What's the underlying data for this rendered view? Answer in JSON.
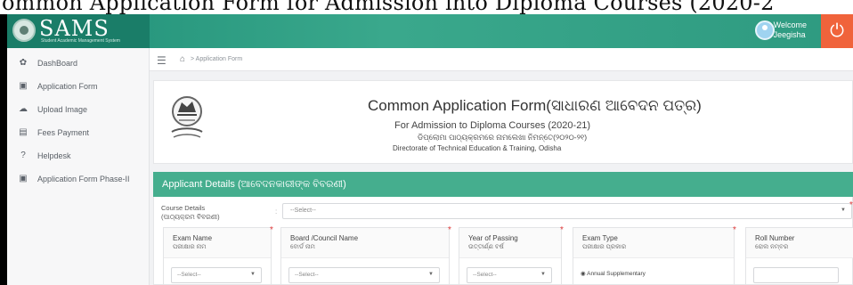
{
  "caption": "ommon Application Form for Admission into Diploma Courses (2020-2",
  "header": {
    "brand": "SAMS",
    "brand_sub": "Student Academic Management System",
    "welcome_line1": "Welcome",
    "welcome_line2": "Jeegisha",
    "power_icon": "power-icon"
  },
  "sidebar": {
    "items": [
      {
        "label": "DashBoard",
        "icon": "dashboard-icon"
      },
      {
        "label": "Application Form",
        "icon": "form-icon"
      },
      {
        "label": "Upload Image",
        "icon": "upload-icon"
      },
      {
        "label": "Fees Payment",
        "icon": "payment-icon"
      },
      {
        "label": "Helpdesk",
        "icon": "help-icon"
      },
      {
        "label": "Application Form Phase-II",
        "icon": "form-icon"
      }
    ]
  },
  "breadcrumb": {
    "home_icon": "home-icon",
    "separator": ">",
    "current": "Application Form"
  },
  "form_header": {
    "title": "Common Application Form(ସାଧାରଣ ଆବେଦନ ପତ୍ର)",
    "subtitle": "For Admission to Diploma Courses (2020-21)",
    "subtitle_odia": "ଡିପ୍ଲୋମା ପାଠ୍ୟକ୍ରମରେ ନାମଲେଖା ନିମନ୍ତେ(୨୦୨୦-୨୧)",
    "directorate": "Directorate of Technical Education & Training, Odisha"
  },
  "applicant": {
    "section_title": "Applicant Details (ଆବେଦନକାରୀଙ୍କ ବିବରଣୀ)",
    "course_label": "Course Details",
    "course_label_odia": "(ପାଠ୍ୟକ୍ରମ ବିବରଣୀ)",
    "course_colon": ":",
    "course_placeholder": "--Select--",
    "columns": [
      {
        "title": "Exam Name",
        "title_odia": "ପରୀକ୍ଷାର ନାମ",
        "value": "--Select--"
      },
      {
        "title": "Board /Council Name",
        "title_odia": "ବୋର୍ଡ ନାମ",
        "value": "--Select--"
      },
      {
        "title": "Year of Passing",
        "title_odia": "ଉତ୍ତୀର୍ଣ୍ଣ ବର୍ଷ",
        "value": "--Select--"
      },
      {
        "title": "Exam Type",
        "title_odia": "ପରୀକ୍ଷାର ପ୍ରକାର",
        "value": "Annual  Supplementary"
      },
      {
        "title": "Roll Number",
        "title_odia": "ରୋଲ ନମ୍ବର",
        "value": ""
      }
    ]
  },
  "colors": {
    "topbar": "#2e9a80",
    "panel_head": "#45ae8e",
    "power": "#f0633b",
    "required": "#e13b3b"
  }
}
